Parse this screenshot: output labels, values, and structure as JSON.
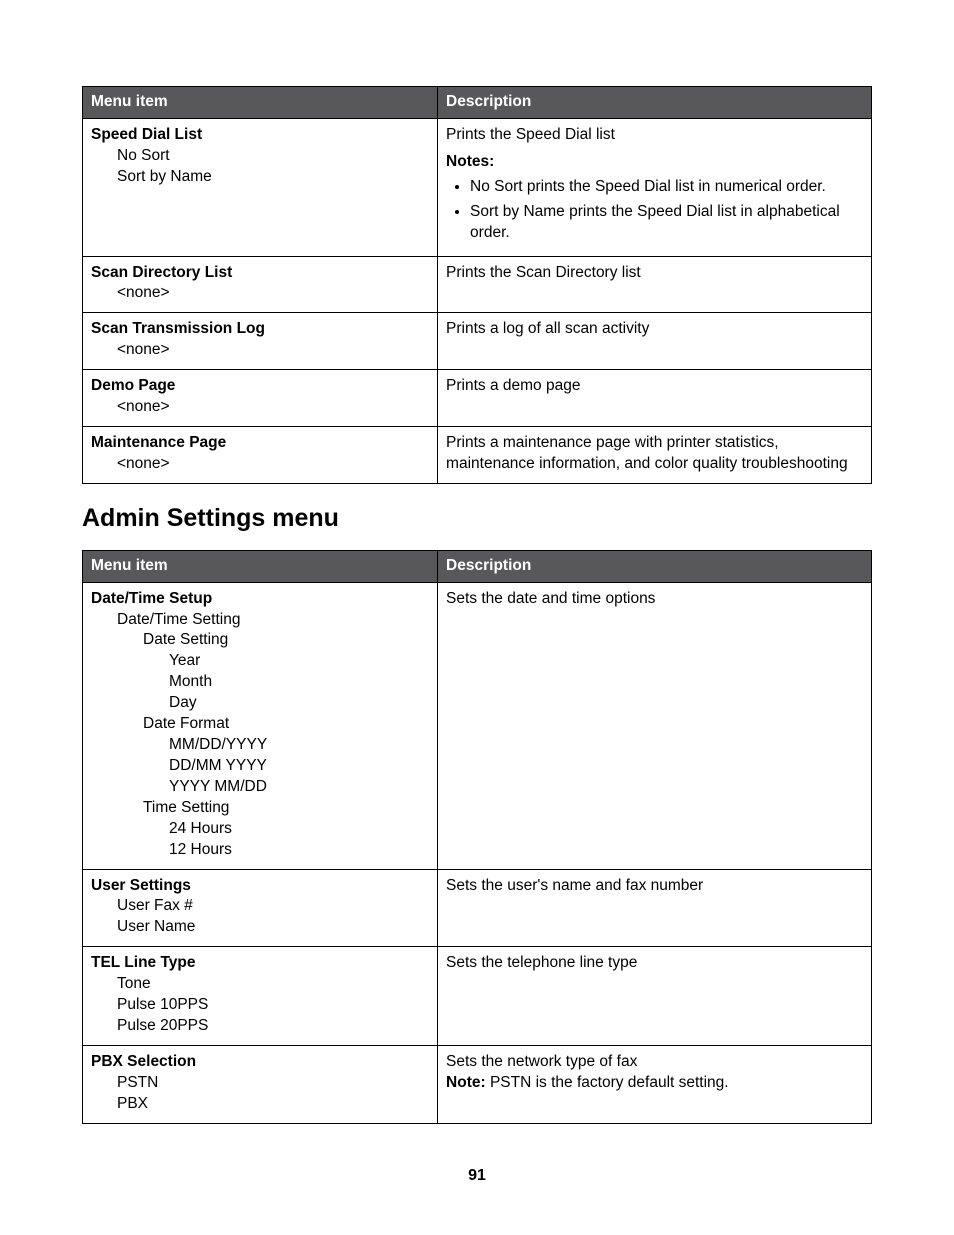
{
  "table1": {
    "headers": {
      "menu": "Menu item",
      "desc": "Description"
    },
    "rows": {
      "speedDial": {
        "title": "Speed Dial List",
        "opt1": "No Sort",
        "opt2": "Sort by Name",
        "desc_intro": "Prints the Speed Dial list",
        "notes_label": "Notes:",
        "note1": "No Sort prints the Speed Dial list in numerical order.",
        "note2": "Sort by Name prints the Speed Dial list in alphabetical order."
      },
      "scanDir": {
        "title": "Scan Directory List",
        "opt1": "<none>",
        "desc": "Prints the Scan Directory list"
      },
      "scanTrans": {
        "title": "Scan Transmission Log",
        "opt1": "<none>",
        "desc": "Prints a log of all scan activity"
      },
      "demo": {
        "title": "Demo Page",
        "opt1": "<none>",
        "desc": "Prints a demo page"
      },
      "maint": {
        "title": "Maintenance Page",
        "opt1": "<none>",
        "desc": "Prints a maintenance page with printer statistics, maintenance information, and color quality troubleshooting"
      }
    }
  },
  "section_heading": "Admin Settings menu",
  "table2": {
    "headers": {
      "menu": "Menu item",
      "desc": "Description"
    },
    "rows": {
      "dateTime": {
        "title": "Date/Time Setup",
        "l1a": "Date/Time Setting",
        "l2a": "Date Setting",
        "l3a": "Year",
        "l3b": "Month",
        "l3c": "Day",
        "l2b": "Date Format",
        "l3d": "MM/DD/YYYY",
        "l3e": "DD/MM YYYY",
        "l3f": "YYYY MM/DD",
        "l2c": "Time Setting",
        "l3g": "24 Hours",
        "l3h": "12 Hours",
        "desc": "Sets the date and time options"
      },
      "userSettings": {
        "title": "User Settings",
        "opt1": "User Fax #",
        "opt2": "User Name",
        "desc": "Sets the user's name and fax number"
      },
      "telLine": {
        "title": "TEL Line Type",
        "opt1": "Tone",
        "opt2": "Pulse 10PPS",
        "opt3": "Pulse 20PPS",
        "desc": "Sets the telephone line type"
      },
      "pbx": {
        "title": "PBX Selection",
        "opt1": "PSTN",
        "opt2": "PBX",
        "desc": "Sets the network type of fax",
        "note_label": "Note:",
        "note_text": " PSTN is the factory default setting."
      }
    }
  },
  "page_number": "91"
}
